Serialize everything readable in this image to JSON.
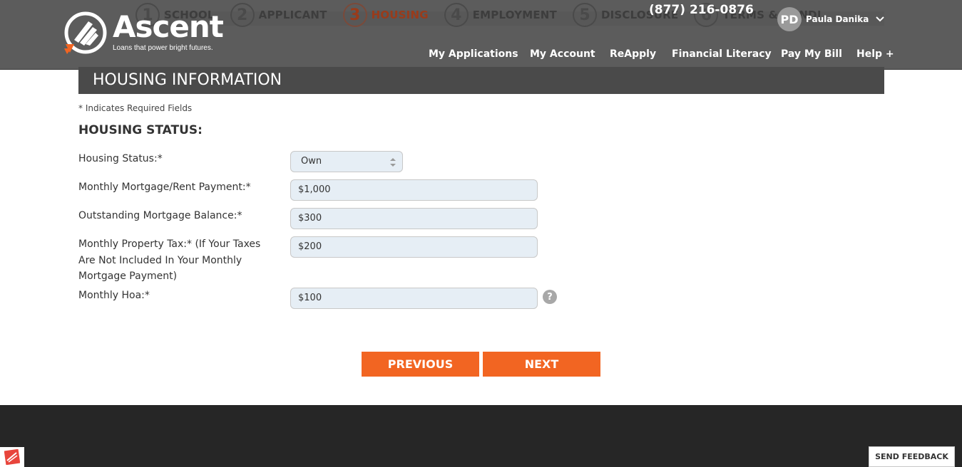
{
  "header": {
    "steps": [
      {
        "num": "1",
        "label": "SCHOOL"
      },
      {
        "num": "2",
        "label": "APPLICANT"
      },
      {
        "num": "3",
        "label": "HOUSING"
      },
      {
        "num": "4",
        "label": "EMPLOYMENT"
      },
      {
        "num": "5",
        "label": "DISCLOSURE"
      },
      {
        "num": "6",
        "label": "TERMS & CONDI"
      }
    ],
    "logo_word": "Ascent",
    "logo_tagline": "Loans that power bright futures.",
    "phone": "(877) 216-0876",
    "user": {
      "initials": "PD",
      "name": "Paula Danika"
    },
    "nav": [
      "My Applications",
      "My Account",
      "ReApply",
      "Financial Literacy",
      "Pay My Bill",
      "Help +"
    ]
  },
  "section_title": "HOUSING INFORMATION",
  "required_note": "* Indicates Required Fields",
  "status_heading": "HOUSING STATUS:",
  "form": {
    "housing_status": {
      "label": "Housing Status:*",
      "value": "Own"
    },
    "monthly_payment": {
      "label": "Monthly Mortgage/Rent Payment:*",
      "value": "$1,000"
    },
    "mortgage_balance": {
      "label": "Outstanding Mortgage Balance:*",
      "value": "$300"
    },
    "property_tax": {
      "label": "Monthly Property Tax:* (If Your Taxes Are Not Included In Your Monthly Mortgage Payment)",
      "value": "$200"
    },
    "hoa": {
      "label": "Monthly Hoa:*",
      "value": "$100"
    }
  },
  "help_glyph": "?",
  "buttons": {
    "previous": "PREVIOUS",
    "next": "NEXT"
  },
  "feedback_label": "SEND FEEDBACK",
  "colors": {
    "accent": "#f26522",
    "header": "#5c5c5c",
    "section": "#4a4a4a",
    "footer": "#262626",
    "field_bg": "#e6eef5"
  }
}
